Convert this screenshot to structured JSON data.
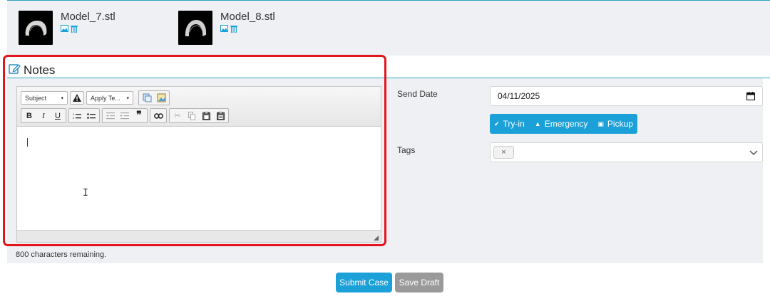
{
  "models": [
    {
      "name": "Model_7.stl",
      "icons": [
        "image-icon",
        "trash-icon"
      ]
    },
    {
      "name": "Model_8.stl",
      "icons": [
        "image-icon",
        "trash-icon"
      ]
    }
  ],
  "notes": {
    "title": "Notes",
    "toolbar": {
      "subject_label": "Subject",
      "apply_template_label": "Apply Te...",
      "row2": [
        "bold",
        "italic",
        "underline",
        "ordered-list",
        "unordered-list",
        "outdent",
        "indent",
        "blockquote",
        "link",
        "cut",
        "copy",
        "paste",
        "paste-text"
      ]
    },
    "chars_remaining": "800 characters remaining."
  },
  "send_date": {
    "label": "Send Date",
    "value": "04/11/2025"
  },
  "options": {
    "try_in": "Try-in",
    "emergency": "Emergency",
    "pickup": "Pickup"
  },
  "tags": {
    "label": "Tags",
    "chip": "×"
  },
  "actions": {
    "submit": "Submit Case",
    "draft": "Save Draft"
  },
  "colors": {
    "accent": "#1ba0d8",
    "highlight": "#e3141e",
    "draft": "#9a9a9a"
  }
}
